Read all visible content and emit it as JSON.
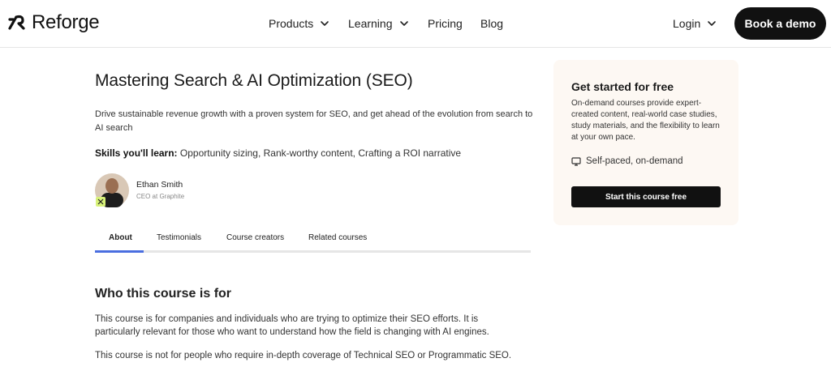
{
  "header": {
    "brand": "Reforge",
    "nav": {
      "products": "Products",
      "learning": "Learning",
      "pricing": "Pricing",
      "blog": "Blog",
      "login": "Login"
    },
    "cta": "Book a demo"
  },
  "course": {
    "title": "Mastering Search & AI Optimization (SEO)",
    "description": "Drive sustainable revenue growth with a proven system for SEO, and get ahead of the evolution from search to AI search",
    "skills_label": "Skills you'll learn:",
    "skills": "Opportunity sizing, Rank-worthy content, Crafting a ROI narrative",
    "author": {
      "name": "Ethan Smith",
      "role": "CEO at Graphite"
    }
  },
  "tabs": [
    {
      "label": "About",
      "active": true
    },
    {
      "label": "Testimonials"
    },
    {
      "label": "Course creators"
    },
    {
      "label": "Related courses"
    }
  ],
  "about": {
    "heading": "Who this course is for",
    "para1": "This course is for companies and individuals who are trying to optimize their SEO efforts. It is particularly relevant for those who want to understand how the field is changing with AI engines.",
    "para2": "This course is not for people who require in-depth coverage of Technical SEO or Programmatic SEO."
  },
  "card": {
    "title": "Get started for free",
    "body": "On-demand courses provide expert-created content, real-world case studies, study materials, and the flexibility to learn at your own pace.",
    "feature": "Self-paced, on-demand",
    "feature_icon": "monitor-icon",
    "button": "Start this course free"
  },
  "colors": {
    "accent": "#4a6ee0",
    "card_bg": "#fdf8f3",
    "button_bg": "#111111"
  }
}
